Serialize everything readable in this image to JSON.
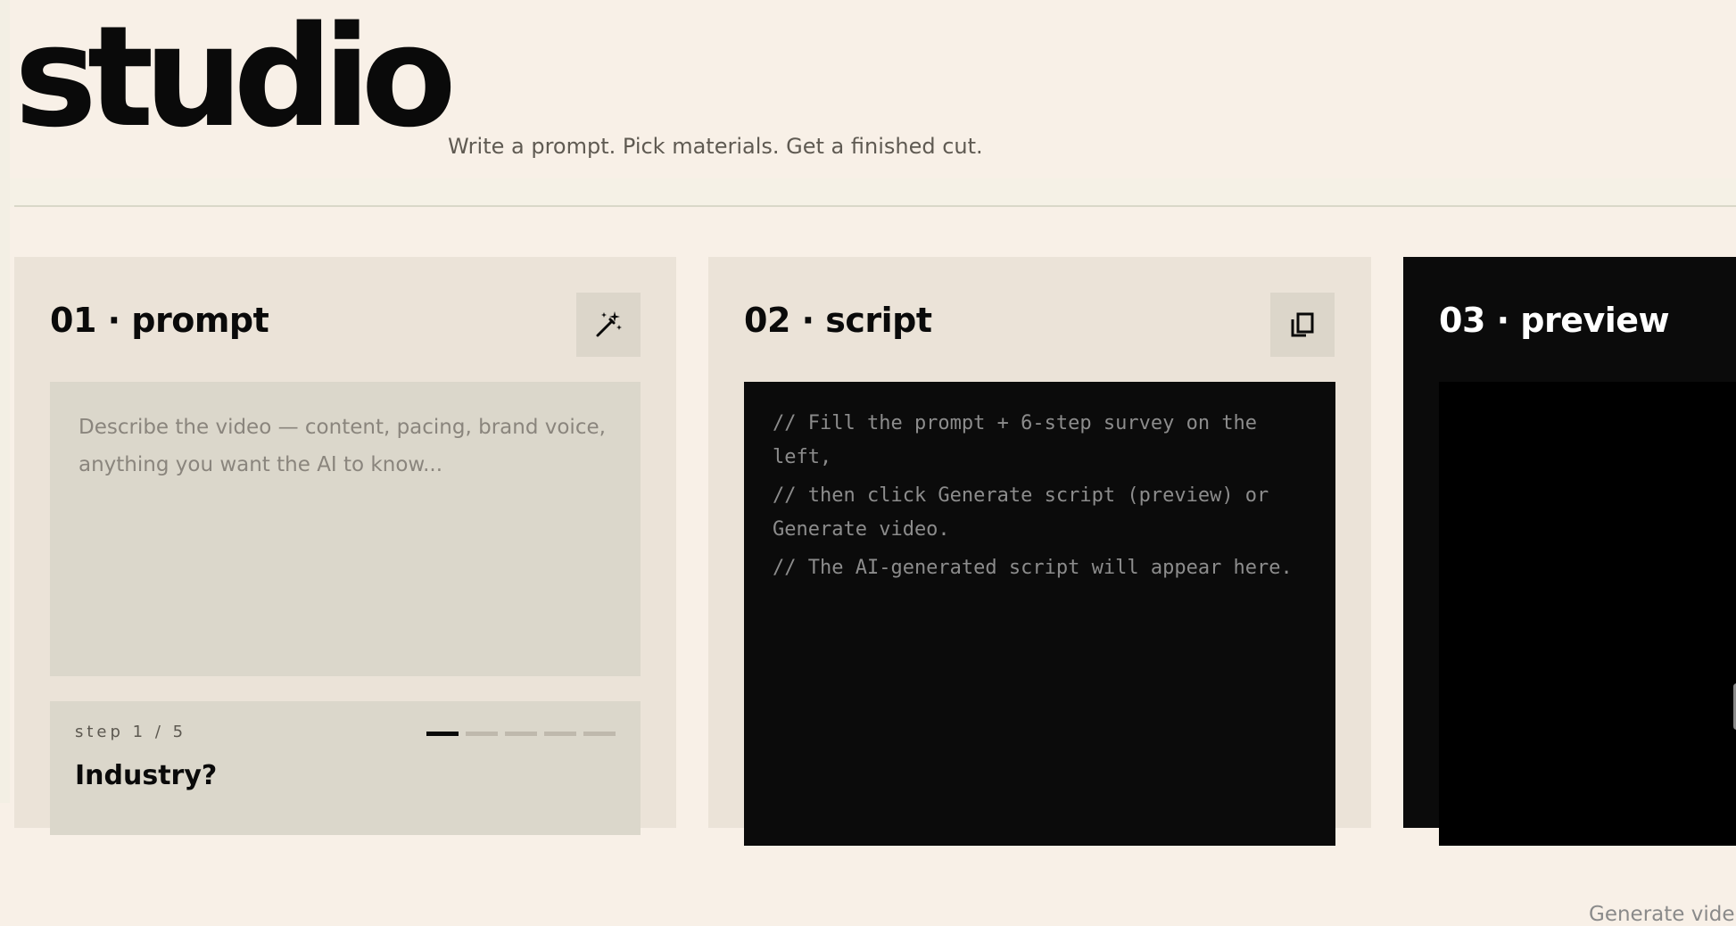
{
  "header": {
    "brand": "studio",
    "tagline": "Write a prompt. Pick materials. Get a finished cut."
  },
  "panels": {
    "prompt": {
      "title": "01 · prompt",
      "action_icon": "magic-wand-icon",
      "placeholder": "Describe the video — content, pacing, brand voice, anything you want the AI to know...",
      "survey": {
        "step_label": "step 1 / 5",
        "current_step": 1,
        "total_steps": 5,
        "question": "Industry?"
      }
    },
    "script": {
      "title": "02 · script",
      "action_icon": "copy-icon",
      "lines": [
        "// Fill the prompt + 6-step survey on the left,",
        "// then click Generate script (preview) or Generate video.",
        "// The AI-generated script will appear here."
      ]
    },
    "preview": {
      "title": "03 · preview",
      "icon": "video-camera-icon",
      "empty_message": "Generate vide"
    }
  },
  "colors": {
    "background": "#f8f0e7",
    "panel": "#ebe3d8",
    "field": "#dbd7cb",
    "dark": "#0b0b0b"
  }
}
